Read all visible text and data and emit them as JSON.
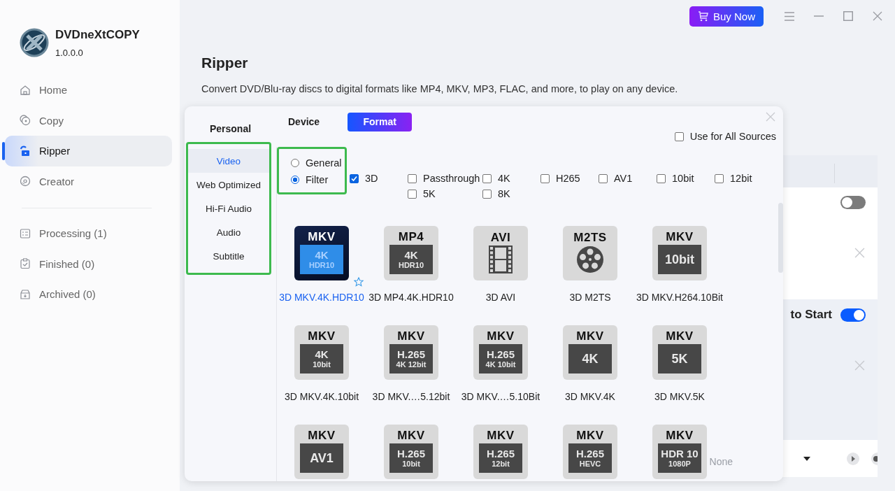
{
  "app": {
    "name": "DVDneXtCOPY",
    "version": "1.0.0.0"
  },
  "nav": [
    {
      "label": "Home",
      "selected": false
    },
    {
      "label": "Copy",
      "selected": false
    },
    {
      "label": "Ripper",
      "selected": true
    },
    {
      "label": "Creator",
      "selected": false
    }
  ],
  "queue": [
    {
      "label": "Processing (1)",
      "selected": false
    },
    {
      "label": "Finished (0)",
      "selected": false
    },
    {
      "label": "Archived (0)",
      "selected": false
    }
  ],
  "top_bar": {
    "buy_button": "Buy Now"
  },
  "page": {
    "title": "Ripper",
    "description": "Convert DVD/Blu-ray discs to digital formats like MP4, MKV, MP3, FLAC, and more, to play on any device."
  },
  "task_panel": {
    "rows": [
      {
        "on": false
      },
      {
        "label": "to Start",
        "on": true
      }
    ]
  },
  "dialog": {
    "personal": {
      "title": "Personal",
      "highlighted": true,
      "items": [
        {
          "label": "Video",
          "selected": true
        },
        {
          "label": "Web Optimized",
          "selected": false
        },
        {
          "label": "Hi-Fi Audio",
          "selected": false
        },
        {
          "label": "Audio",
          "selected": false
        },
        {
          "label": "Subtitle",
          "selected": false
        }
      ]
    },
    "tabs": [
      {
        "label": "Device",
        "selected": false
      },
      {
        "label": "Format",
        "selected": true
      }
    ],
    "use_for_all": {
      "label": "Use for All Sources",
      "checked": false
    },
    "mode": {
      "highlighted": true,
      "options": [
        {
          "label": "General",
          "selected": false
        },
        {
          "label": "Filter",
          "selected": true
        }
      ]
    },
    "lead_filter": {
      "label": "3D",
      "checked": true
    },
    "filters": [
      {
        "label": "Passthrough",
        "checked": false
      },
      {
        "label": "4K",
        "checked": false
      },
      {
        "label": "H265",
        "checked": false
      },
      {
        "label": "AV1",
        "checked": false
      },
      {
        "label": "10bit",
        "checked": false
      },
      {
        "label": "12bit",
        "checked": false
      },
      {
        "label": "5K",
        "checked": false
      },
      {
        "label": "8K",
        "checked": false
      }
    ],
    "formats": [
      {
        "kind": "badge",
        "top": "MKV",
        "lines": [
          "4K",
          "HDR10"
        ],
        "label": "3D MKV.4K.HDR10",
        "selected": true,
        "favorite": true
      },
      {
        "kind": "badge",
        "top": "MP4",
        "lines": [
          "4K",
          "HDR10"
        ],
        "label": "3D MP4.4K.HDR10",
        "selected": false
      },
      {
        "kind": "film",
        "top": "AVI",
        "label": "3D AVI",
        "selected": false
      },
      {
        "kind": "reel",
        "top": "M2TS",
        "label": "3D M2TS",
        "selected": false
      },
      {
        "kind": "badge",
        "top": "MKV",
        "lines": [
          "10bit"
        ],
        "label": "3D MKV.H264.10Bit",
        "selected": false
      },
      {
        "kind": "badge",
        "top": "MKV",
        "lines": [
          "4K",
          "10bit"
        ],
        "label": "3D MKV.4K.10bit",
        "selected": false
      },
      {
        "kind": "badge",
        "top": "MKV",
        "lines": [
          "H.265",
          "4K 12bit"
        ],
        "label": "3D MKV.…5.12bit",
        "selected": false
      },
      {
        "kind": "badge",
        "top": "MKV",
        "lines": [
          "H.265",
          "4K 10bit"
        ],
        "label": "3D MKV.…5.10Bit",
        "selected": false
      },
      {
        "kind": "badge",
        "top": "MKV",
        "lines": [
          "4K"
        ],
        "label": "3D MKV.4K",
        "selected": false
      },
      {
        "kind": "badge",
        "top": "MKV",
        "lines": [
          "5K"
        ],
        "label": "3D MKV.5K",
        "selected": false
      },
      {
        "kind": "badge",
        "top": "MKV",
        "lines": [
          "AV1"
        ],
        "selected": false
      },
      {
        "kind": "badge",
        "top": "MKV",
        "lines": [
          "H.265",
          "10bit"
        ],
        "selected": false
      },
      {
        "kind": "badge",
        "top": "MKV",
        "lines": [
          "H.265",
          "12bit"
        ],
        "selected": false
      },
      {
        "kind": "badge",
        "top": "MKV",
        "lines": [
          "H.265",
          "HEVC"
        ],
        "selected": false
      },
      {
        "kind": "badge",
        "top": "MKV",
        "lines": [
          "HDR 10",
          "1080P"
        ],
        "selected": false
      }
    ],
    "dropdown_value": "None"
  }
}
